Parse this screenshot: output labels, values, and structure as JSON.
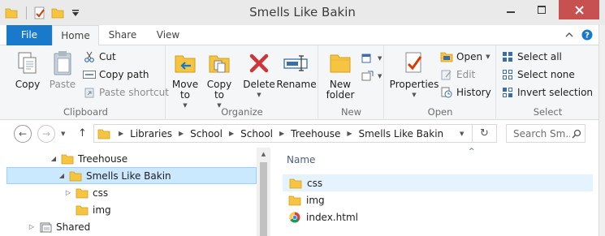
{
  "window": {
    "title": "Smells Like Bakin",
    "controls": [
      "minimize-icon",
      "maximize-icon",
      "close-icon"
    ]
  },
  "quick_access": [
    "folder-icon",
    "properties-icon",
    "new-folder-icon",
    "customize-dropdown-icon"
  ],
  "tabs": {
    "file": "File",
    "home": "Home",
    "share": "Share",
    "view": "View",
    "active": "Home"
  },
  "ribbon": {
    "clipboard": {
      "label": "Clipboard",
      "copy": "Copy",
      "paste": "Paste",
      "cut": "Cut",
      "copy_path": "Copy path",
      "paste_shortcut": "Paste shortcut"
    },
    "organize": {
      "label": "Organize",
      "move_to": "Move to",
      "copy_to": "Copy to",
      "delete": "Delete",
      "rename": "Rename"
    },
    "new": {
      "label": "New",
      "new_folder": "New folder"
    },
    "open": {
      "label": "Open",
      "properties": "Properties",
      "open": "Open",
      "edit": "Edit",
      "history": "History"
    },
    "select": {
      "label": "Select",
      "select_all": "Select all",
      "select_none": "Select none",
      "invert_selection": "Invert selection"
    }
  },
  "address": {
    "path": [
      "Libraries",
      "School",
      "School",
      "Treehouse",
      "Smells Like Bakin"
    ]
  },
  "search": {
    "placeholder": "Search Sm..."
  },
  "nav_tree": {
    "items": [
      {
        "label": "Treehouse",
        "glyph": "◢"
      },
      {
        "label": "Smells Like Bakin",
        "glyph": "◢"
      },
      {
        "label": "css",
        "glyph": "▷"
      },
      {
        "label": "img",
        "glyph": ""
      },
      {
        "label": "Shared",
        "glyph": "▷"
      }
    ],
    "selected": "Smells Like Bakin"
  },
  "file_list": {
    "column": "Name",
    "files": [
      {
        "name": "css",
        "type": "folder"
      },
      {
        "name": "img",
        "type": "folder"
      },
      {
        "name": "index.html",
        "type": "chrome-html"
      }
    ]
  },
  "colors": {
    "file_tab": "#1979ca",
    "close_button": "#c75050",
    "selection": "#cce8ff",
    "folder": "#f5c542"
  }
}
